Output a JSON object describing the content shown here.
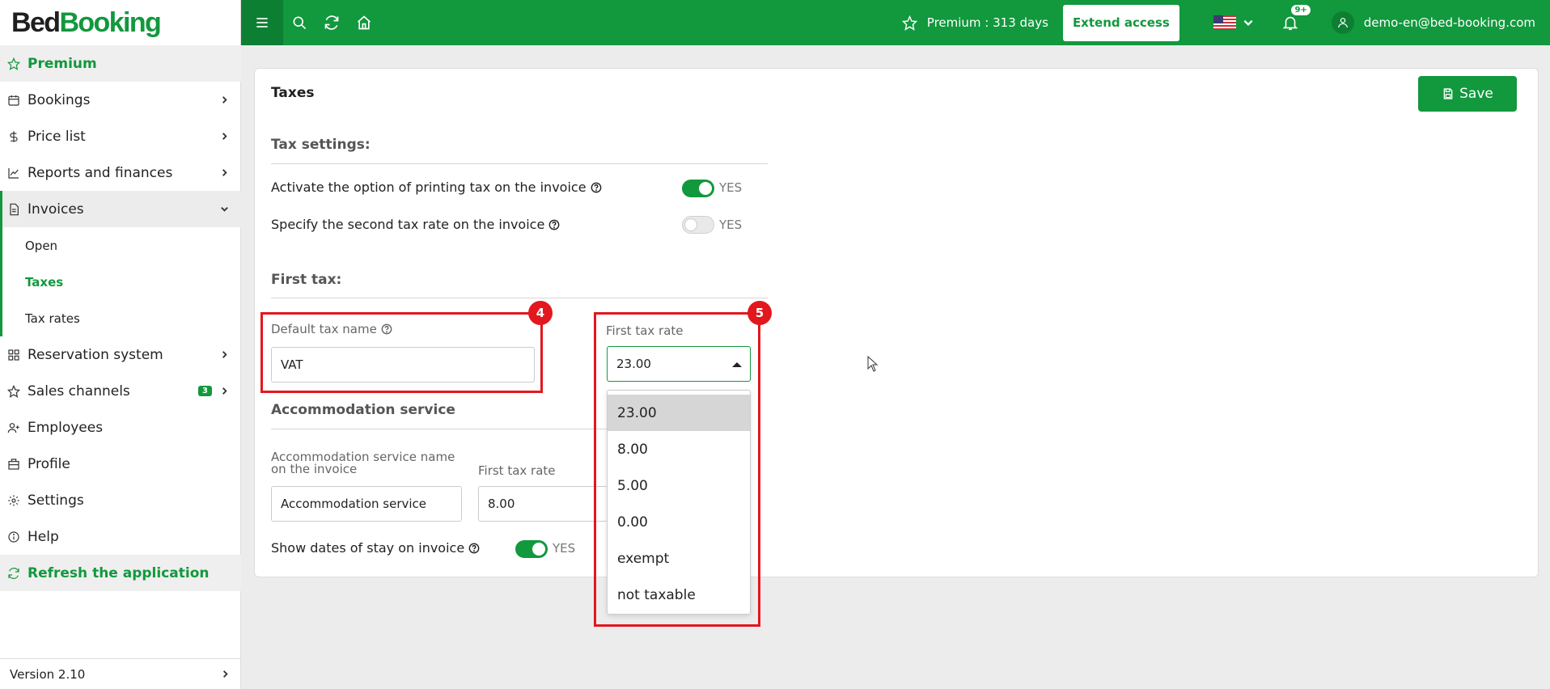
{
  "sidebar": {
    "logo_bed": "Bed",
    "logo_booking": "Booking",
    "items": [
      {
        "label": "Premium",
        "icon": "star-icon"
      },
      {
        "label": "Bookings",
        "icon": "calendar-icon"
      },
      {
        "label": "Price list",
        "icon": "dollar-icon"
      },
      {
        "label": "Reports and finances",
        "icon": "chart-icon"
      },
      {
        "label": "Invoices",
        "icon": "invoice-icon"
      },
      {
        "label": "Reservation system",
        "icon": "grid-icon"
      },
      {
        "label": "Sales channels",
        "icon": "star-icon",
        "badge": "3"
      },
      {
        "label": "Employees",
        "icon": "user-plus-icon"
      },
      {
        "label": "Profile",
        "icon": "building-icon"
      },
      {
        "label": "Settings",
        "icon": "gear-icon"
      },
      {
        "label": "Help",
        "icon": "info-icon"
      },
      {
        "label": "Refresh the application",
        "icon": "refresh-icon"
      }
    ],
    "invoice_sub": [
      "Open",
      "Taxes",
      "Tax rates"
    ],
    "version": "Version 2.10"
  },
  "topbar": {
    "premium_text": "Premium : 313 days",
    "extend_label": "Extend access",
    "notifications": "9+",
    "user_email": "demo-en@bed-booking.com"
  },
  "page": {
    "title": "Taxes",
    "save_label": "Save",
    "tax_settings_heading": "Tax settings:",
    "print_tax_label": "Activate the option of printing tax on the invoice",
    "second_tax_label": "Specify the second tax rate on the invoice",
    "yes_label": "YES",
    "first_tax_heading": "First tax:",
    "default_tax_name_label": "Default tax name",
    "default_tax_name_value": "VAT",
    "first_tax_rate_label": "First tax rate",
    "first_tax_rate_value": "23.00",
    "rate_options": [
      "23.00",
      "8.00",
      "5.00",
      "0.00",
      "exempt",
      "not taxable"
    ],
    "accommodation_heading": "Accommodation service",
    "acc_name_label": "Accommodation service name on the invoice",
    "acc_name_value": "Accommodation service",
    "acc_rate_label": "First tax rate",
    "acc_rate_value": "8.00",
    "show_dates_label": "Show dates of stay on invoice"
  },
  "annotations": [
    "4",
    "5"
  ],
  "colors": {
    "brand": "#12983d",
    "annotation": "#e3171e"
  }
}
